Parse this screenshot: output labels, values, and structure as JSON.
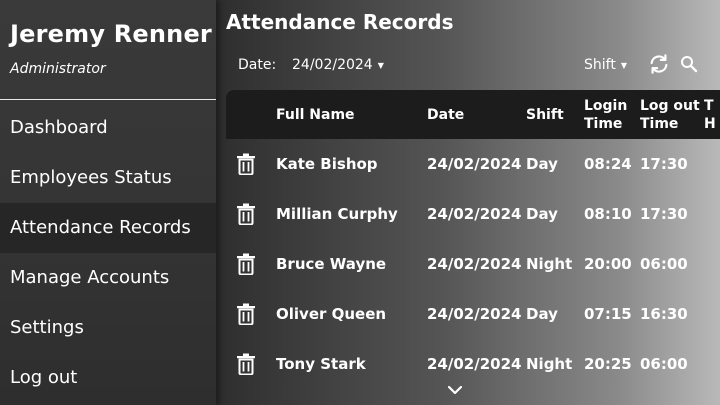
{
  "user": {
    "name": "Jeremy Renner",
    "role": "Administrator"
  },
  "nav": [
    {
      "label": "Dashboard"
    },
    {
      "label": "Employees Status"
    },
    {
      "label": "Attendance Records"
    },
    {
      "label": "Manage Accounts"
    },
    {
      "label": "Settings"
    },
    {
      "label": "Log out"
    }
  ],
  "active_nav": "Attendance Records",
  "page_title": "Attendance Records",
  "filters": {
    "date_label": "Date:",
    "date_value": "24/02/2024",
    "shift_label": "Shift"
  },
  "table": {
    "columns": {
      "full_name": "Full Name",
      "date": "Date",
      "shift": "Shift",
      "login_1": "Login",
      "login_2": "Time",
      "logout_1": "Log out",
      "logout_2": "Time",
      "total_1": "T",
      "total_2": "H"
    },
    "rows": [
      {
        "name": "Kate Bishop",
        "date": "24/02/2024",
        "shift": "Day",
        "login": "08:24",
        "logout": "17:30"
      },
      {
        "name": "Millian Curphy",
        "date": "24/02/2024",
        "shift": "Day",
        "login": "08:10",
        "logout": "17:30"
      },
      {
        "name": "Bruce Wayne",
        "date": "24/02/2024",
        "shift": "Night",
        "login": "20:00",
        "logout": "06:00"
      },
      {
        "name": "Oliver Queen",
        "date": "24/02/2024",
        "shift": "Day",
        "login": "07:15",
        "logout": "16:30"
      },
      {
        "name": "Tony Stark",
        "date": "24/02/2024",
        "shift": "Night",
        "login": "20:25",
        "logout": "06:00"
      }
    ]
  },
  "icons": {
    "delete": "trash-icon",
    "refresh": "refresh-icon",
    "search": "search-icon",
    "more": "chevron-down-icon",
    "dropdown": "caret-down-icon"
  }
}
